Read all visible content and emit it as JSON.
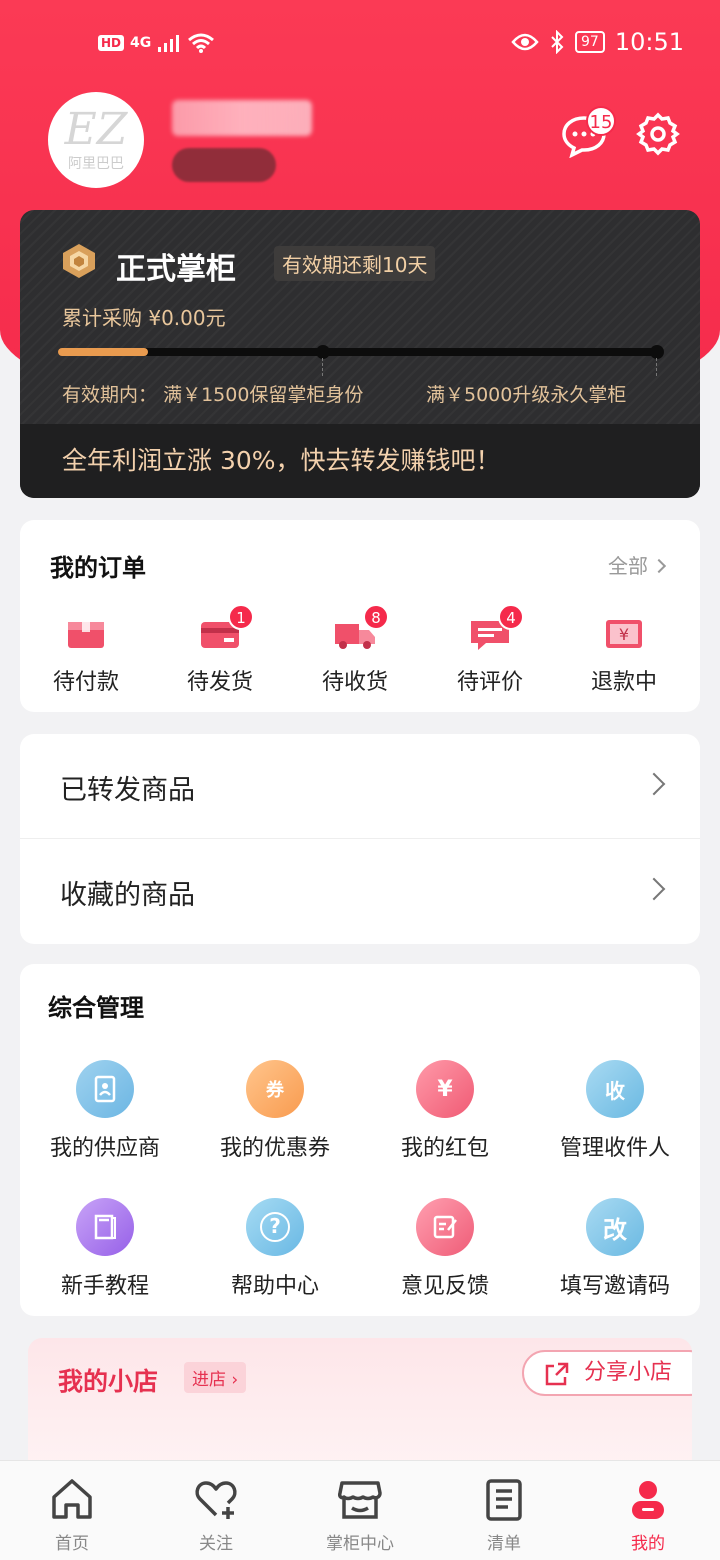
{
  "status_bar": {
    "network_hd": "HD",
    "network_type": "4G",
    "battery": "97",
    "time": "10:51"
  },
  "header": {
    "avatar_logo": "EZ",
    "avatar_logo_text": "阿里巴巴",
    "message_count": "15"
  },
  "vip": {
    "title": "正式掌柜",
    "validity": "有效期还剩10天",
    "total_purchase": "累计采购 ¥0.00元",
    "rule_label": "有效期内：",
    "rule_keep": "满￥1500保留掌柜身份",
    "rule_upgrade": "满￥5000升级永久掌柜",
    "promo": "全年利润立涨 30%，快去转发赚钱吧！",
    "progress_percent": 15
  },
  "orders": {
    "title": "我的订单",
    "all_label": "全部",
    "items": [
      {
        "label": "待付款",
        "badge": ""
      },
      {
        "label": "待发货",
        "badge": "1"
      },
      {
        "label": "待收货",
        "badge": "8"
      },
      {
        "label": "待评价",
        "badge": "4"
      },
      {
        "label": "退款中",
        "badge": ""
      }
    ]
  },
  "links": {
    "forwarded": "已转发商品",
    "favorites": "收藏的商品"
  },
  "management": {
    "title": "综合管理",
    "items": [
      {
        "label": "我的供应商",
        "icon": "contacts-icon"
      },
      {
        "label": "我的优惠券",
        "icon": "coupon-icon",
        "glyph": "券"
      },
      {
        "label": "我的红包",
        "icon": "red-packet-icon",
        "glyph": "¥"
      },
      {
        "label": "管理收件人",
        "icon": "recipient-icon",
        "glyph": "收"
      },
      {
        "label": "新手教程",
        "icon": "book-icon"
      },
      {
        "label": "帮助中心",
        "icon": "help-icon",
        "glyph": "?"
      },
      {
        "label": "意见反馈",
        "icon": "feedback-icon"
      },
      {
        "label": "填写邀请码",
        "icon": "invite-code-icon",
        "glyph": "改"
      }
    ]
  },
  "shop": {
    "title": "我的小店",
    "enter_label": "进店",
    "share_label": "分享小店"
  },
  "tabbar": {
    "items": [
      {
        "label": "首页"
      },
      {
        "label": "关注"
      },
      {
        "label": "掌柜中心"
      },
      {
        "label": "清单"
      },
      {
        "label": "我的"
      }
    ],
    "active_index": 4
  },
  "colors": {
    "brand_red": "#f52a4b",
    "gold": "#e99b4f",
    "dark_card": "#2e2e30"
  }
}
